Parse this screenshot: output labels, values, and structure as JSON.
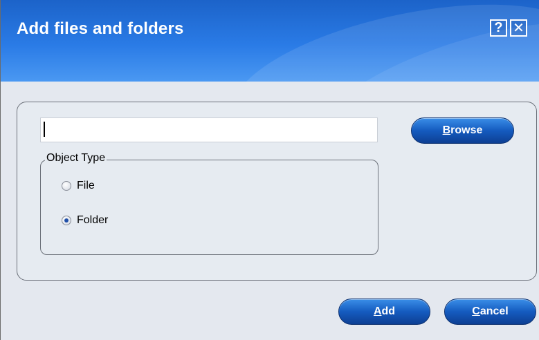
{
  "dialog": {
    "title": "Add files and folders",
    "help_label": "?",
    "close_label": "✕"
  },
  "path_input": {
    "value": "",
    "placeholder": ""
  },
  "buttons": {
    "browse_first": "B",
    "browse_rest": "rowse",
    "add_first": "A",
    "add_rest": "dd",
    "cancel_first": "C",
    "cancel_rest": "ancel"
  },
  "object_type": {
    "legend": "Object Type",
    "options": [
      {
        "label": "File",
        "checked": false
      },
      {
        "label": "Folder",
        "checked": true
      }
    ]
  },
  "colors": {
    "title_bar": "#2a7be6",
    "button": "#155bbf",
    "panel_bg": "#e6ebf1"
  }
}
